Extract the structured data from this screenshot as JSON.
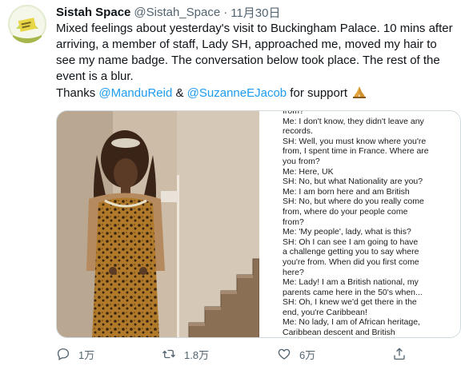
{
  "tweet": {
    "display_name": "Sistah Space",
    "handle": "@Sistah_Space",
    "separator": "·",
    "date": "11月30日",
    "text": "Mixed feelings about yesterday's visit to Buckingham Palace. 10 mins after arriving, a member of staff, Lady SH, approached me, moved my hair to see my name badge. The conversation below took place. The rest of the event is a blur.",
    "thanks_prefix": "Thanks ",
    "mention_1": "@ManduReid",
    "amp": " & ",
    "mention_2": "@SuzanneEJacob",
    "thanks_suffix": " for support"
  },
  "conversation_lines": [
    "from?",
    "Me: I don't know, they didn't leave any",
    "records.",
    "SH: Well, you must know where you're",
    "from, I spent time in France. Where are",
    "you from?",
    "Me: Here, UK",
    "SH: No, but what Nationality are you?",
    "Me: I am born here and am British",
    "SH: No, but where do you really come",
    "from, where do your people come",
    "from?",
    "Me: 'My people', lady, what is this?",
    "SH: Oh I can see I am going to have",
    "a challenge getting you to say where",
    "you're from. When did you first come",
    "here?",
    "Me: Lady! I am a British national, my",
    "parents came here in the 50's when...",
    "SH: Oh, I knew we'd get there in the",
    "end, you're Caribbean!",
    "Me: No lady, I am of African heritage,",
    "Caribbean descent and British"
  ],
  "actions": {
    "reply_count": "1万",
    "retweet_count": "1.8万",
    "like_count": "6万"
  },
  "colors": {
    "text": "#0f1419",
    "secondary": "#536471",
    "link": "#1d9bf0",
    "border": "#cfd9de"
  },
  "icons": [
    "reply-icon",
    "retweet-icon",
    "like-icon",
    "share-icon",
    "folded-hands-emoji"
  ]
}
